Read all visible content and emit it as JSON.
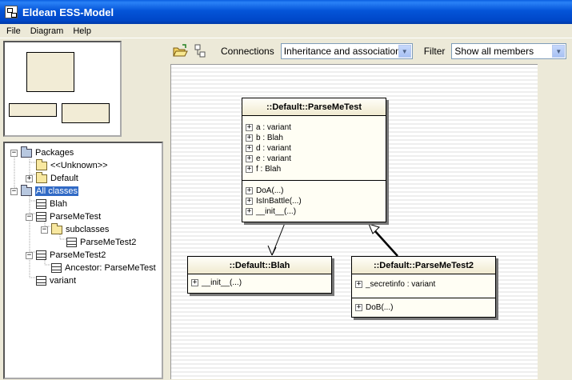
{
  "window": {
    "title": "Eldean ESS-Model"
  },
  "menu": [
    "File",
    "Diagram",
    "Help"
  ],
  "toolbar": {
    "connections_label": "Connections",
    "connections_value": "Inheritance and associations",
    "filter_label": "Filter",
    "filter_value": "Show all members"
  },
  "tree": {
    "packages": "Packages",
    "unknown": "<<Unknown>>",
    "default": "Default",
    "all_classes": "All classes",
    "blah": "Blah",
    "parsemetest": "ParseMeTest",
    "subclasses": "subclasses",
    "parsemetest2_child": "ParseMeTest2",
    "parsemetest2": "ParseMeTest2",
    "ancestor": "Ancestor: ParseMeTest",
    "variant": "variant"
  },
  "classes": {
    "parsemetest": {
      "name": "::Default::ParseMeTest",
      "attributes": [
        "a : variant",
        "b : Blah",
        "d : variant",
        "e : variant",
        "f : Blah"
      ],
      "operations": [
        "DoA(...)",
        "IsInBattle(...)",
        "__init__(...)"
      ]
    },
    "blah": {
      "name": "::Default::Blah",
      "operations": [
        "__init__(...)"
      ]
    },
    "parsemetest2": {
      "name": "::Default::ParseMeTest2",
      "attributes": [
        "_secretinfo : variant"
      ],
      "operations": [
        "DoB(...)"
      ]
    }
  }
}
